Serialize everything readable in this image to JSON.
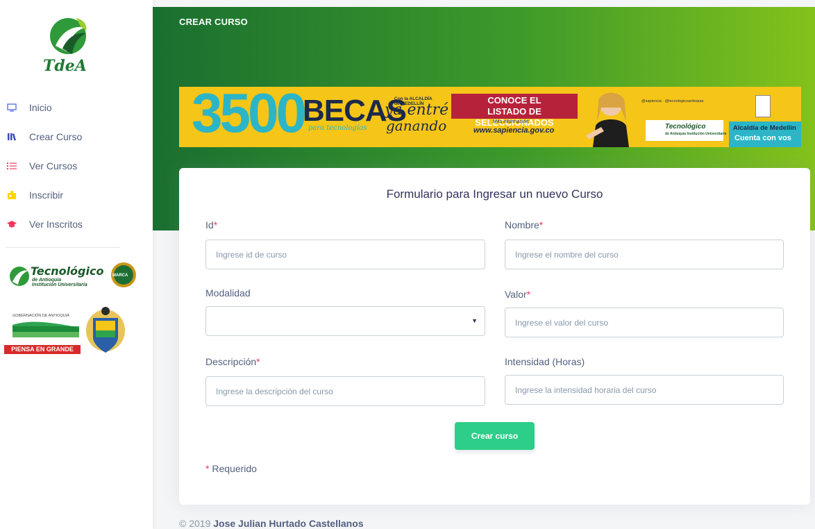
{
  "sidebar": {
    "brand": "TdeA",
    "items": [
      {
        "label": "Inicio",
        "icon": "monitor-icon"
      },
      {
        "label": "Crear Curso",
        "icon": "books-icon"
      },
      {
        "label": "Ver Cursos",
        "icon": "list-icon"
      },
      {
        "label": "Inscribir",
        "icon": "badge-icon"
      },
      {
        "label": "Ver Inscritos",
        "icon": "graduation-cap-icon"
      }
    ],
    "logo_tec": {
      "word": "Tecnológico",
      "sub1": "de Antioquia",
      "sub2": "Institución Universitaria",
      "seal": "MARCA"
    },
    "logo_gob": {
      "title": "GOBERNACIÓN DE ANTIOQUIA",
      "slogan": "PIENSA EN GRANDE"
    }
  },
  "header": {
    "title": "CREAR CURSO"
  },
  "banner": {
    "number": "3500",
    "becas": "BECAS",
    "para": "para tecnologías",
    "con": "Con la ALCALDÍA de MEDELLÍN",
    "ya": "ya entré",
    "ganando": "ganando",
    "conoce_l1": "CONOCE EL",
    "conoce_l2": "LISTADO DE SELECCIONADOS",
    "mas_info": "Más información:",
    "url": "www.sapiencia.gov.co",
    "social": "@sapiencia · @tecnologicoantioquia",
    "tec_word": "Tecnológico",
    "tec_sub": "de Antioquia Institución Universitaria",
    "alc_l1": "Alcaldía de Medellín",
    "alc_l2": "Cuenta con vos"
  },
  "form": {
    "title": "Formulario para Ingresar un nuevo Curso",
    "id_label": "Id",
    "id_placeholder": "Ingrese id de curso",
    "nombre_label": "Nombre",
    "nombre_placeholder": "Ingrese el nombre del curso",
    "modalidad_label": "Modalidad",
    "modalidad_value": "",
    "valor_label": "Valor",
    "valor_placeholder": "Ingrese el valor del curso",
    "descripcion_label": "Descripción",
    "descripcion_placeholder": "Ingrese la descripción del curso",
    "intensidad_label": "Intensidad (Horas)",
    "intensidad_placeholder": "Ingrese la intensidad horaria del curso",
    "required_mark": "*",
    "submit_label": "Crear curso",
    "required_note": "Requerido"
  },
  "footer": {
    "year": "© 2019",
    "author": "Jose Julian Hurtado Castellanos"
  },
  "colors": {
    "primary_green": "#2dce89",
    "required": "#f5365c",
    "header_start": "#1a6f30",
    "header_end": "#84c21b"
  }
}
